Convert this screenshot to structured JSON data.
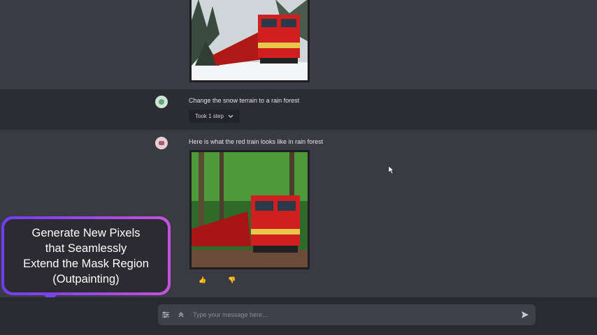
{
  "conversation": {
    "user_message": "Change the snow terrain to a rain forest",
    "step_label": "Took 1 step",
    "assistant_message": "Here is what the red train looks like in rain forest"
  },
  "images": {
    "top_image": "red-train-snow",
    "result_image": "red-train-rainforest"
  },
  "reactions": {
    "thumbs_up": "👍",
    "thumbs_down": "👎"
  },
  "callout": {
    "text": "Generate New Pixels\nthat Seamlessly\nExtend the Mask Region\n(Outpainting)"
  },
  "composer": {
    "placeholder": "Type your message here..."
  },
  "colors": {
    "train_red": "#d11f1f",
    "callout_gradient_start": "#6f3ef0",
    "callout_gradient_end": "#c652dc"
  }
}
